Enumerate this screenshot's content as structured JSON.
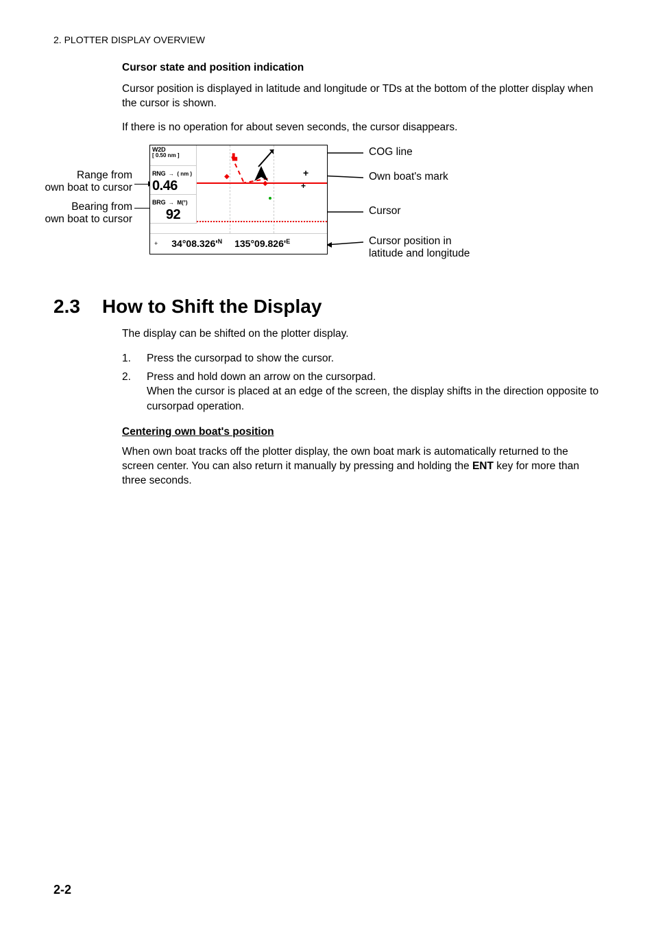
{
  "header": "2.  PLOTTER DISPLAY OVERVIEW",
  "s1": {
    "heading": "Cursor state and position indication",
    "p1": "Cursor position is displayed in latitude and longitude or TDs at the bottom of the plotter display when the cursor is shown.",
    "p2": "If there is no operation for about seven seconds, the cursor disappears."
  },
  "figure": {
    "w2d_label": "W2D",
    "w2d_val": "[ 0.50 nm ]",
    "rng_label": "RNG",
    "rng_arrow": "→",
    "rng_unit": "( nm )",
    "rng_val": "0.46",
    "brg_label": "BRG",
    "brg_arrow": "→",
    "brg_unit": "M(°)",
    "brg_val": "92",
    "lat": "34°08.326'",
    "lat_ns": "N",
    "lon": "135°09.826'",
    "lon_ew": "E",
    "left1a": "Range from",
    "left1b": "own boat to cursor",
    "left2a": "Bearing from",
    "left2b": "own boat to cursor",
    "right1": "COG line",
    "right2": "Own boat's mark",
    "right3": "Cursor",
    "right4a": "Cursor position in",
    "right4b": "latitude and longitude"
  },
  "s2": {
    "num": "2.3",
    "title": "How to Shift the Display",
    "intro": "The display can be shifted on the plotter display.",
    "step1": "Press the cursorpad to show the cursor.",
    "step2a": "Press and hold down an arrow on the cursorpad.",
    "step2b": "When the cursor is placed at an edge of the screen, the display shifts in the direc­tion opposite to cursorpad operation.",
    "sub": "Centering own boat's position",
    "p": "When own boat tracks off the plotter display, the own boat mark is automatically re­turned to the screen center. You can also return it manually by pressing and holding the ",
    "key": "ENT",
    "p_tail": " key for more than three seconds."
  },
  "page": "2-2"
}
